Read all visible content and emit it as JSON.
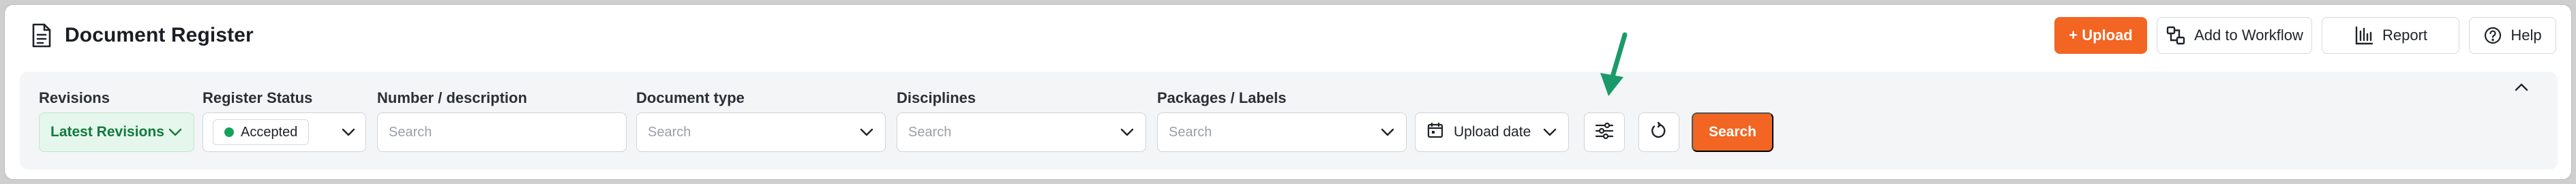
{
  "header": {
    "title": "Document Register",
    "actions": {
      "upload": "+ Upload",
      "add_to_workflow": "Add to Workflow",
      "report": "Report",
      "help": "Help"
    }
  },
  "filters": {
    "revisions": {
      "label": "Revisions",
      "value": "Latest Revisions"
    },
    "register_status": {
      "label": "Register Status",
      "value": "Accepted",
      "status_color": "#15a35b"
    },
    "number_description": {
      "label": "Number / description",
      "placeholder": "Search"
    },
    "document_type": {
      "label": "Document type",
      "placeholder": "Search"
    },
    "disciplines": {
      "label": "Disciplines",
      "placeholder": "Search"
    },
    "packages_labels": {
      "label": "Packages / Labels",
      "placeholder": "Search"
    },
    "sort": {
      "value": "Upload date"
    },
    "search_button": "Search"
  },
  "colors": {
    "accent": "#f26522",
    "annotation_arrow": "#1a9a6b"
  },
  "icons": {
    "title": "document-icon",
    "workflow": "workflow-icon",
    "report": "bar-chart-icon",
    "help": "question-circle-icon",
    "advanced_filters": "sliders-icon",
    "reset": "refresh-icon",
    "collapse": "chevron-up-icon"
  }
}
